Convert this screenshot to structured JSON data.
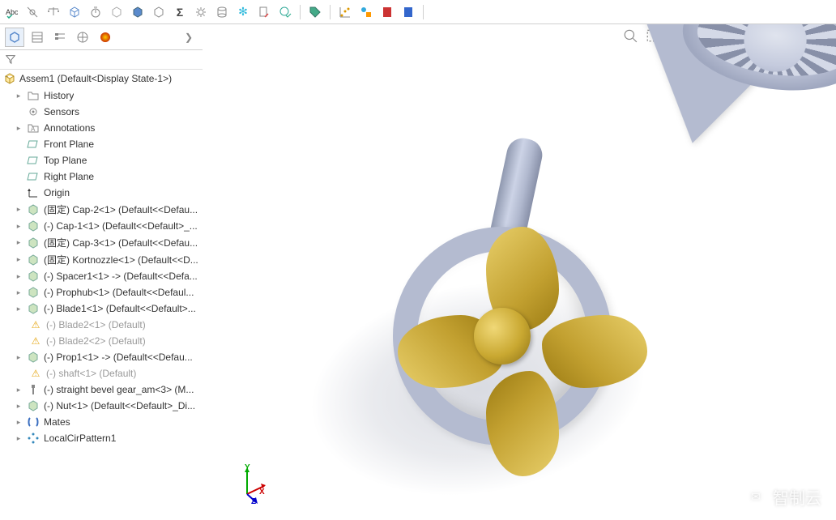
{
  "assembly_name": "Assem1  (Default<Display State-1>)",
  "tree": {
    "history": "History",
    "sensors": "Sensors",
    "annotations": "Annotations",
    "front_plane": "Front Plane",
    "top_plane": "Top Plane",
    "right_plane": "Right Plane",
    "origin": "Origin",
    "items": [
      "(固定) Cap-2<1> (Default<<Defau...",
      "(-) Cap-1<1> (Default<<Default>_...",
      "(固定) Cap-3<1> (Default<<Defau...",
      "(固定) Kortnozzle<1> (Default<<D...",
      "(-) Spacer1<1> -> (Default<<Defa...",
      "(-) Prophub<1> (Default<<Defaul...",
      "(-) Blade1<1> (Default<<Default>..."
    ],
    "sub_items": [
      "(-) Blade2<1> (Default)",
      "(-) Blade2<2> (Default)"
    ],
    "items2": [
      "(-) Prop1<1> -> (Default<<Defau..."
    ],
    "sub_items2": [
      "(-) shaft<1> (Default)"
    ],
    "items3": [
      "(-) straight bevel gear_am<3> (M...",
      "(-) Nut<1> (Default<<Default>_Di..."
    ],
    "mates": "Mates",
    "pattern": "LocalCirPattern1"
  },
  "triad": {
    "x": "X",
    "y": "Y",
    "z": "Z"
  },
  "watermark": "智制云"
}
